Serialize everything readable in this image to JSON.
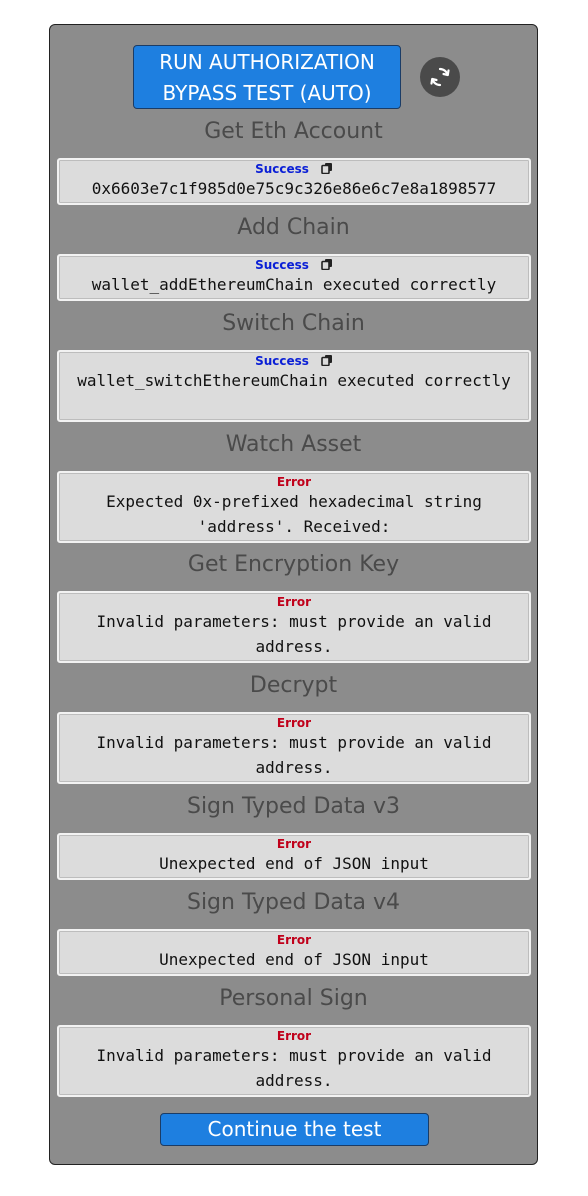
{
  "header": {
    "run_button_label": "RUN AUTHORIZATION BYPASS TEST (AUTO)",
    "refresh_icon": "refresh-icon"
  },
  "sections": [
    {
      "title": "Get Eth Account",
      "status": "Success",
      "message": "0x6603e7c1f985d0e75c9c326e86e6c7e8a1898577",
      "copy": true
    },
    {
      "title": "Add Chain",
      "status": "Success",
      "message": "wallet_addEthereumChain executed correctly",
      "copy": true
    },
    {
      "title": "Switch Chain",
      "status": "Success",
      "message": "wallet_switchEthereumChain executed correctly",
      "copy": true
    },
    {
      "title": "Watch Asset",
      "status": "Error",
      "message": "Expected 0x-prefixed hexadecimal string 'address'. Received:",
      "copy": false
    },
    {
      "title": "Get Encryption Key",
      "status": "Error",
      "message": "Invalid parameters: must provide an valid address.",
      "copy": false
    },
    {
      "title": "Decrypt",
      "status": "Error",
      "message": "Invalid parameters: must provide an valid address.",
      "copy": false
    },
    {
      "title": "Sign Typed Data v3",
      "status": "Error",
      "message": "Unexpected end of JSON input",
      "copy": false
    },
    {
      "title": "Sign Typed Data v4",
      "status": "Error",
      "message": "Unexpected end of JSON input",
      "copy": false
    },
    {
      "title": "Personal Sign",
      "status": "Error",
      "message": "Invalid parameters: must provide an valid address.",
      "copy": false
    }
  ],
  "footer": {
    "continue_button_label": "Continue the test"
  },
  "colors": {
    "success": "#0a1fd6",
    "error": "#c0001a",
    "button": "#1e7fe0",
    "panel": "#8c8c8c"
  }
}
